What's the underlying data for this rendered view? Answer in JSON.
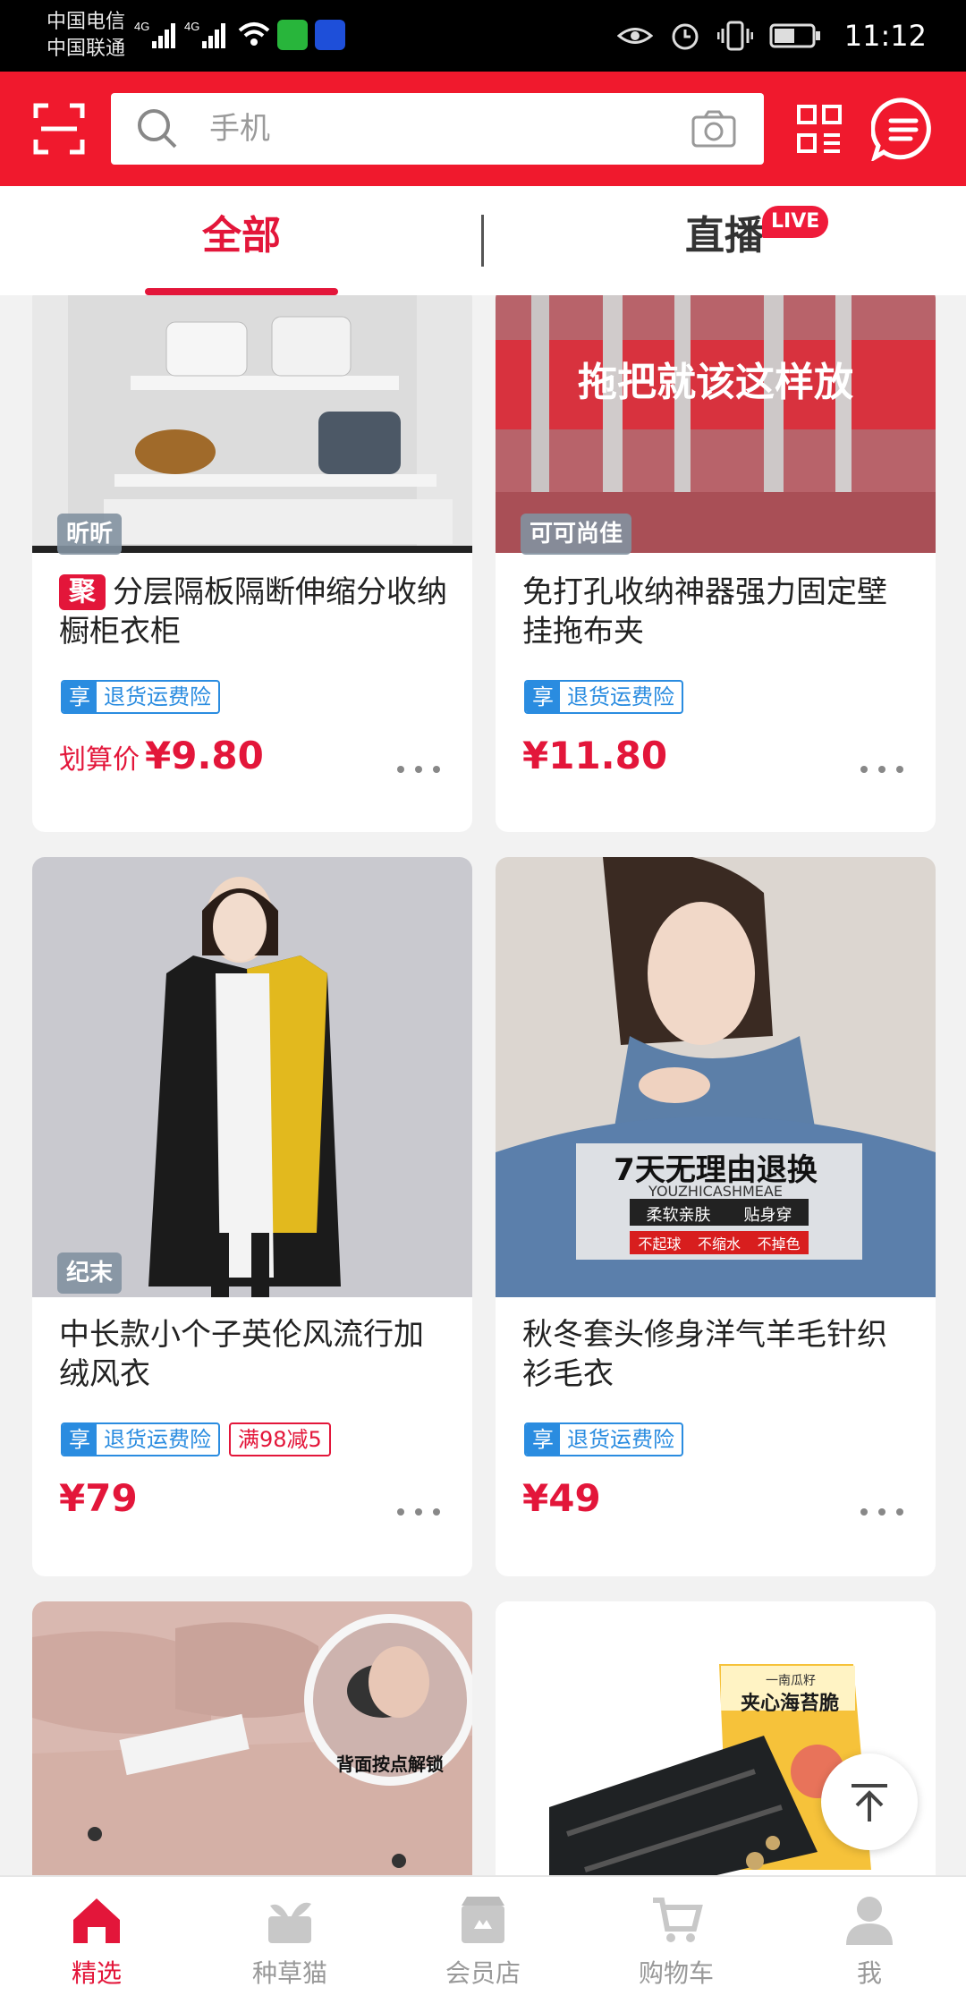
{
  "status_bar": {
    "carrier1": "中国电信",
    "carrier2": "中国联通",
    "time": "11:12"
  },
  "header": {
    "search_placeholder": "手机"
  },
  "tabs": [
    {
      "label": "全部"
    },
    {
      "label": "直播"
    }
  ],
  "live_badge": "LIVE",
  "products": [
    {
      "shop": "昕昕",
      "badge": "聚",
      "title": "分层隔板隔断伸缩分收纳橱柜衣柜",
      "insurance_prefix": "享",
      "insurance": "退货运费险",
      "price_prefix": "划算价",
      "price": "¥9.80"
    },
    {
      "shop": "可可尚佳",
      "title": "免打孔收纳神器强力固定壁挂拖布夹",
      "insurance_prefix": "享",
      "insurance": "退货运费险",
      "price": "¥11.80",
      "image_text": "拖把就该这样放"
    },
    {
      "shop": "纪末",
      "title": "中长款小个子英伦风流行加绒风衣",
      "insurance_prefix": "享",
      "insurance": "退货运费险",
      "promo": "满98减5",
      "price": "¥79"
    },
    {
      "title": "秋冬套头修身洋气羊毛针织衫毛衣",
      "insurance_prefix": "享",
      "insurance": "退货运费险",
      "price": "¥49",
      "image_text": "7天无理由退换",
      "image_subtext": "YOUZHICASHMEAE",
      "image_tags": [
        "柔软亲肤",
        "贴身穿"
      ],
      "image_tags2": [
        "不起球",
        "不缩水",
        "不掉色"
      ]
    },
    {
      "image_text": "背面按点解锁"
    },
    {
      "image_text": "夹心海苔脆",
      "image_subtext": "一南瓜籽"
    }
  ],
  "bottom_nav": [
    {
      "label": "精选",
      "active": true
    },
    {
      "label": "种草猫"
    },
    {
      "label": "会员店"
    },
    {
      "label": "购物车"
    },
    {
      "label": "我"
    }
  ]
}
